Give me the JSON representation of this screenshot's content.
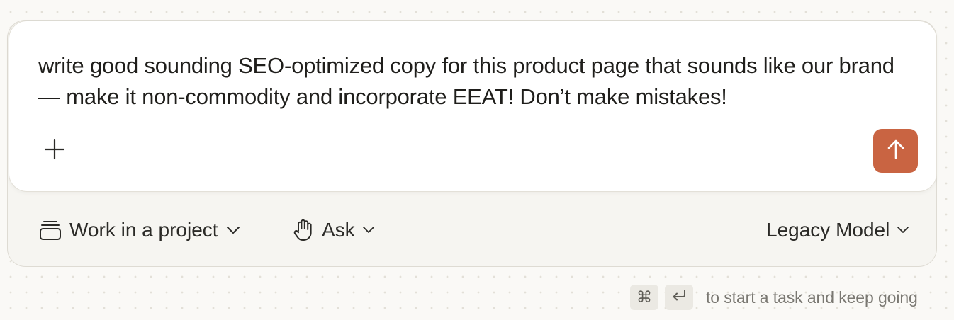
{
  "composer": {
    "prompt_text": "write good sounding SEO-optimized copy for this product page that sounds like our brand — make it non-commodity and incorporate EEAT! Don’t make mistakes!",
    "attach_icon": "plus-icon",
    "send_icon": "arrow-up-icon",
    "accent_color": "#c96442"
  },
  "toolbar": {
    "project_label": "Work in a project",
    "project_icon": "stack-icon",
    "mode_label": "Ask",
    "mode_icon": "hand-icon",
    "model_label": "Legacy Model"
  },
  "hint": {
    "key_1": "⌘",
    "key_2_icon": "return-icon",
    "text": "to start a task and keep going"
  }
}
